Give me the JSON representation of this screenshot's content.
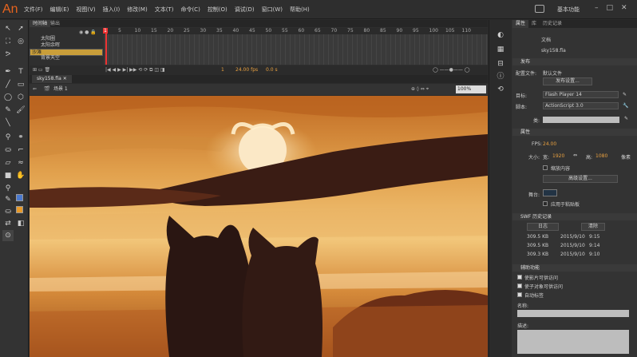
{
  "app": {
    "logo": "An",
    "workspace": "基本功能"
  },
  "menus": [
    "文件(F)",
    "编辑(E)",
    "视图(V)",
    "插入(I)",
    "修改(M)",
    "文本(T)",
    "命令(C)",
    "控制(O)",
    "调试(D)",
    "窗口(W)",
    "帮助(H)"
  ],
  "timeline": {
    "tabs": [
      "时间轴",
      "输出"
    ],
    "layers": [
      {
        "name": "太阳圈",
        "selected": false
      },
      {
        "name": "太阳余晖",
        "selected": false
      },
      {
        "name": "沙滩",
        "selected": true
      },
      {
        "name": "背景天空",
        "selected": false
      }
    ],
    "ruler": [
      "5",
      "10",
      "15",
      "20",
      "25",
      "30",
      "35",
      "40",
      "45",
      "50",
      "55",
      "60",
      "65",
      "70",
      "75",
      "80",
      "85",
      "90",
      "95",
      "100",
      "105",
      "110"
    ],
    "current_frame": "1",
    "fps": "24.00 fps",
    "time": "0.0 s"
  },
  "document": {
    "tab": "sky158.fla",
    "scene": "场景 1",
    "zoom": "100%"
  },
  "properties": {
    "tabs": [
      "属性",
      "库",
      "历史记录"
    ],
    "doc_label": "文档",
    "doc_name": "sky158.fla",
    "publish": {
      "header": "发布",
      "profile_label": "配置文件:",
      "profile_value": "默认文件",
      "publish_settings_btn": "发布设置...",
      "target_label": "目标:",
      "target_value": "Flash Player 14",
      "script_label": "脚本:",
      "script_value": "ActionScript 3.0",
      "class_label": "类:"
    },
    "props": {
      "header": "属性",
      "fps_label": "FPS:",
      "fps_value": "24.00",
      "size_label": "大小:",
      "width_label": "宽:",
      "width_value": "1920",
      "height_label": "高:",
      "height_value": "1080",
      "unit": "像素",
      "scale_content": "缩放内容",
      "advanced_btn": "高级设置...",
      "stage_label": "舞台:",
      "stage_color": "#223344",
      "apply_pasteboard": "应用于粘贴板"
    },
    "swf": {
      "header": "SWF 历史记录",
      "log_btn": "日志",
      "clear_btn": "清除",
      "rows": [
        {
          "size": "309.5 KB",
          "date": "2015/9/10",
          "time": "9:15"
        },
        {
          "size": "309.5 KB",
          "date": "2015/9/10",
          "time": "9:14"
        },
        {
          "size": "309.3 KB",
          "date": "2015/9/10",
          "time": "9:10"
        }
      ]
    },
    "a11y": {
      "header": "辅助功能",
      "opt1": "使影片可供访问",
      "opt2": "使子对象可供访问",
      "opt3": "自动标签",
      "name_label": "名称:",
      "desc_label": "描述:"
    }
  },
  "colors": {
    "accent": "#e8641e",
    "layer_selected": "#c99e3a",
    "sky_top": "#c8762a",
    "sky_mid": "#e9b35f",
    "silhouette": "#2a1612"
  }
}
